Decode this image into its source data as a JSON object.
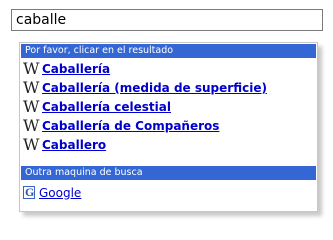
{
  "search": {
    "value": "caballe"
  },
  "suggestions": {
    "header": "Por favor, clicar en el resultado",
    "icon": "W",
    "icon_name": "wikipedia-icon",
    "header_color": "#3467d4",
    "items": [
      {
        "label": "Caballería"
      },
      {
        "label": "Caballería (medida de superficie)"
      },
      {
        "label": "Caballería celestial"
      },
      {
        "label": "Caballería de Compañeros"
      },
      {
        "label": "Caballero"
      }
    ]
  },
  "other_engines": {
    "header": "Outra maquina de busca",
    "items": [
      {
        "icon": "G",
        "icon_name": "google-icon",
        "label": "Google"
      }
    ]
  }
}
